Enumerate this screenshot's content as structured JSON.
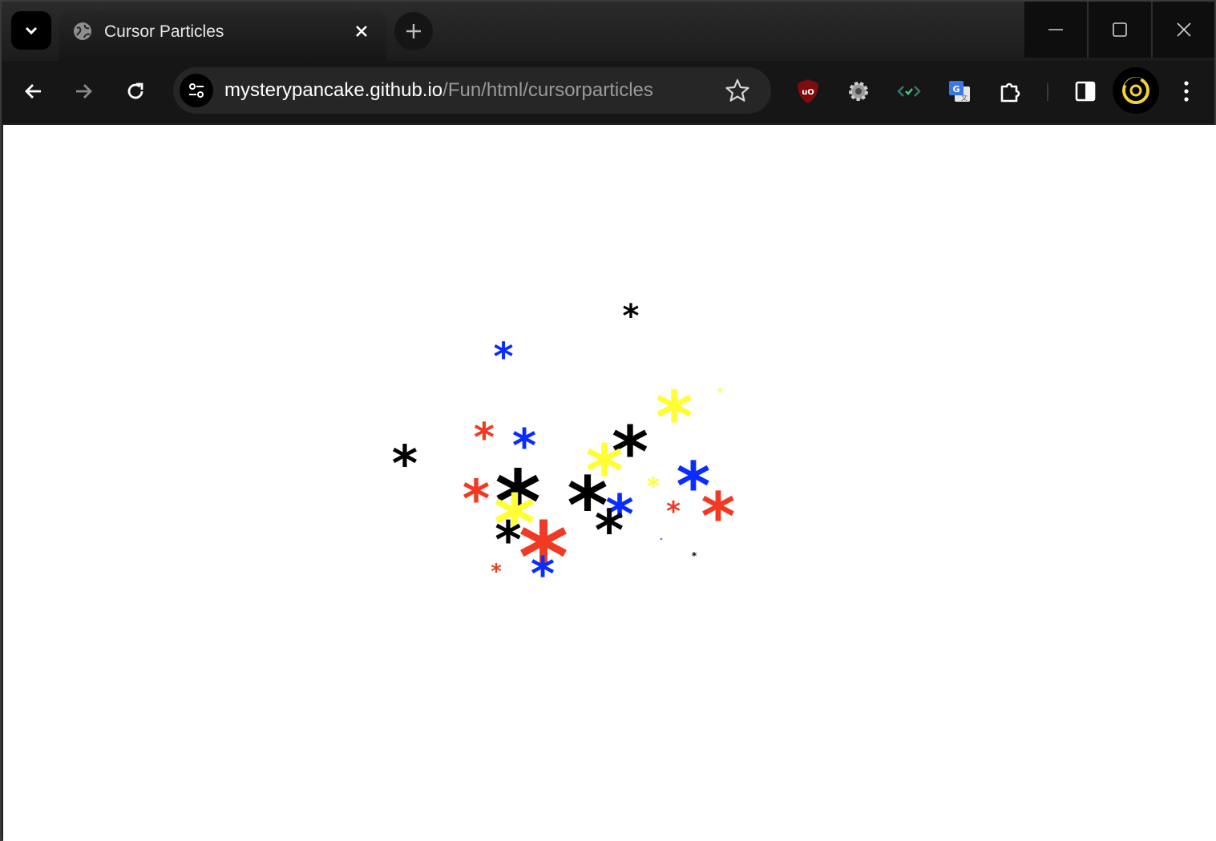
{
  "tab": {
    "title": "Cursor Particles"
  },
  "omnibox": {
    "url_host": "mysterypancake.github.io",
    "url_path": "/Fun/html/cursorparticles"
  },
  "icons": {
    "tab_search": "chevron-down-icon",
    "favicon": "globe-icon",
    "tab_close": "close-icon",
    "new_tab": "plus-icon",
    "back": "arrow-left-icon",
    "forward": "arrow-right-icon",
    "reload": "reload-icon",
    "site_info": "tune-icon",
    "bookmark": "star-icon",
    "extensions": [
      "ublock-icon",
      "gear-icon",
      "code-check-icon",
      "translate-icon"
    ],
    "extensions_menu": "puzzle-icon",
    "side_panel": "side-panel-icon",
    "menu": "kebab-menu-icon"
  },
  "colors": {
    "red": "#f03a24",
    "blue": "#0a2cff",
    "yellow": "#ffff33",
    "black": "#000000"
  },
  "particle_glyph": "*"
}
